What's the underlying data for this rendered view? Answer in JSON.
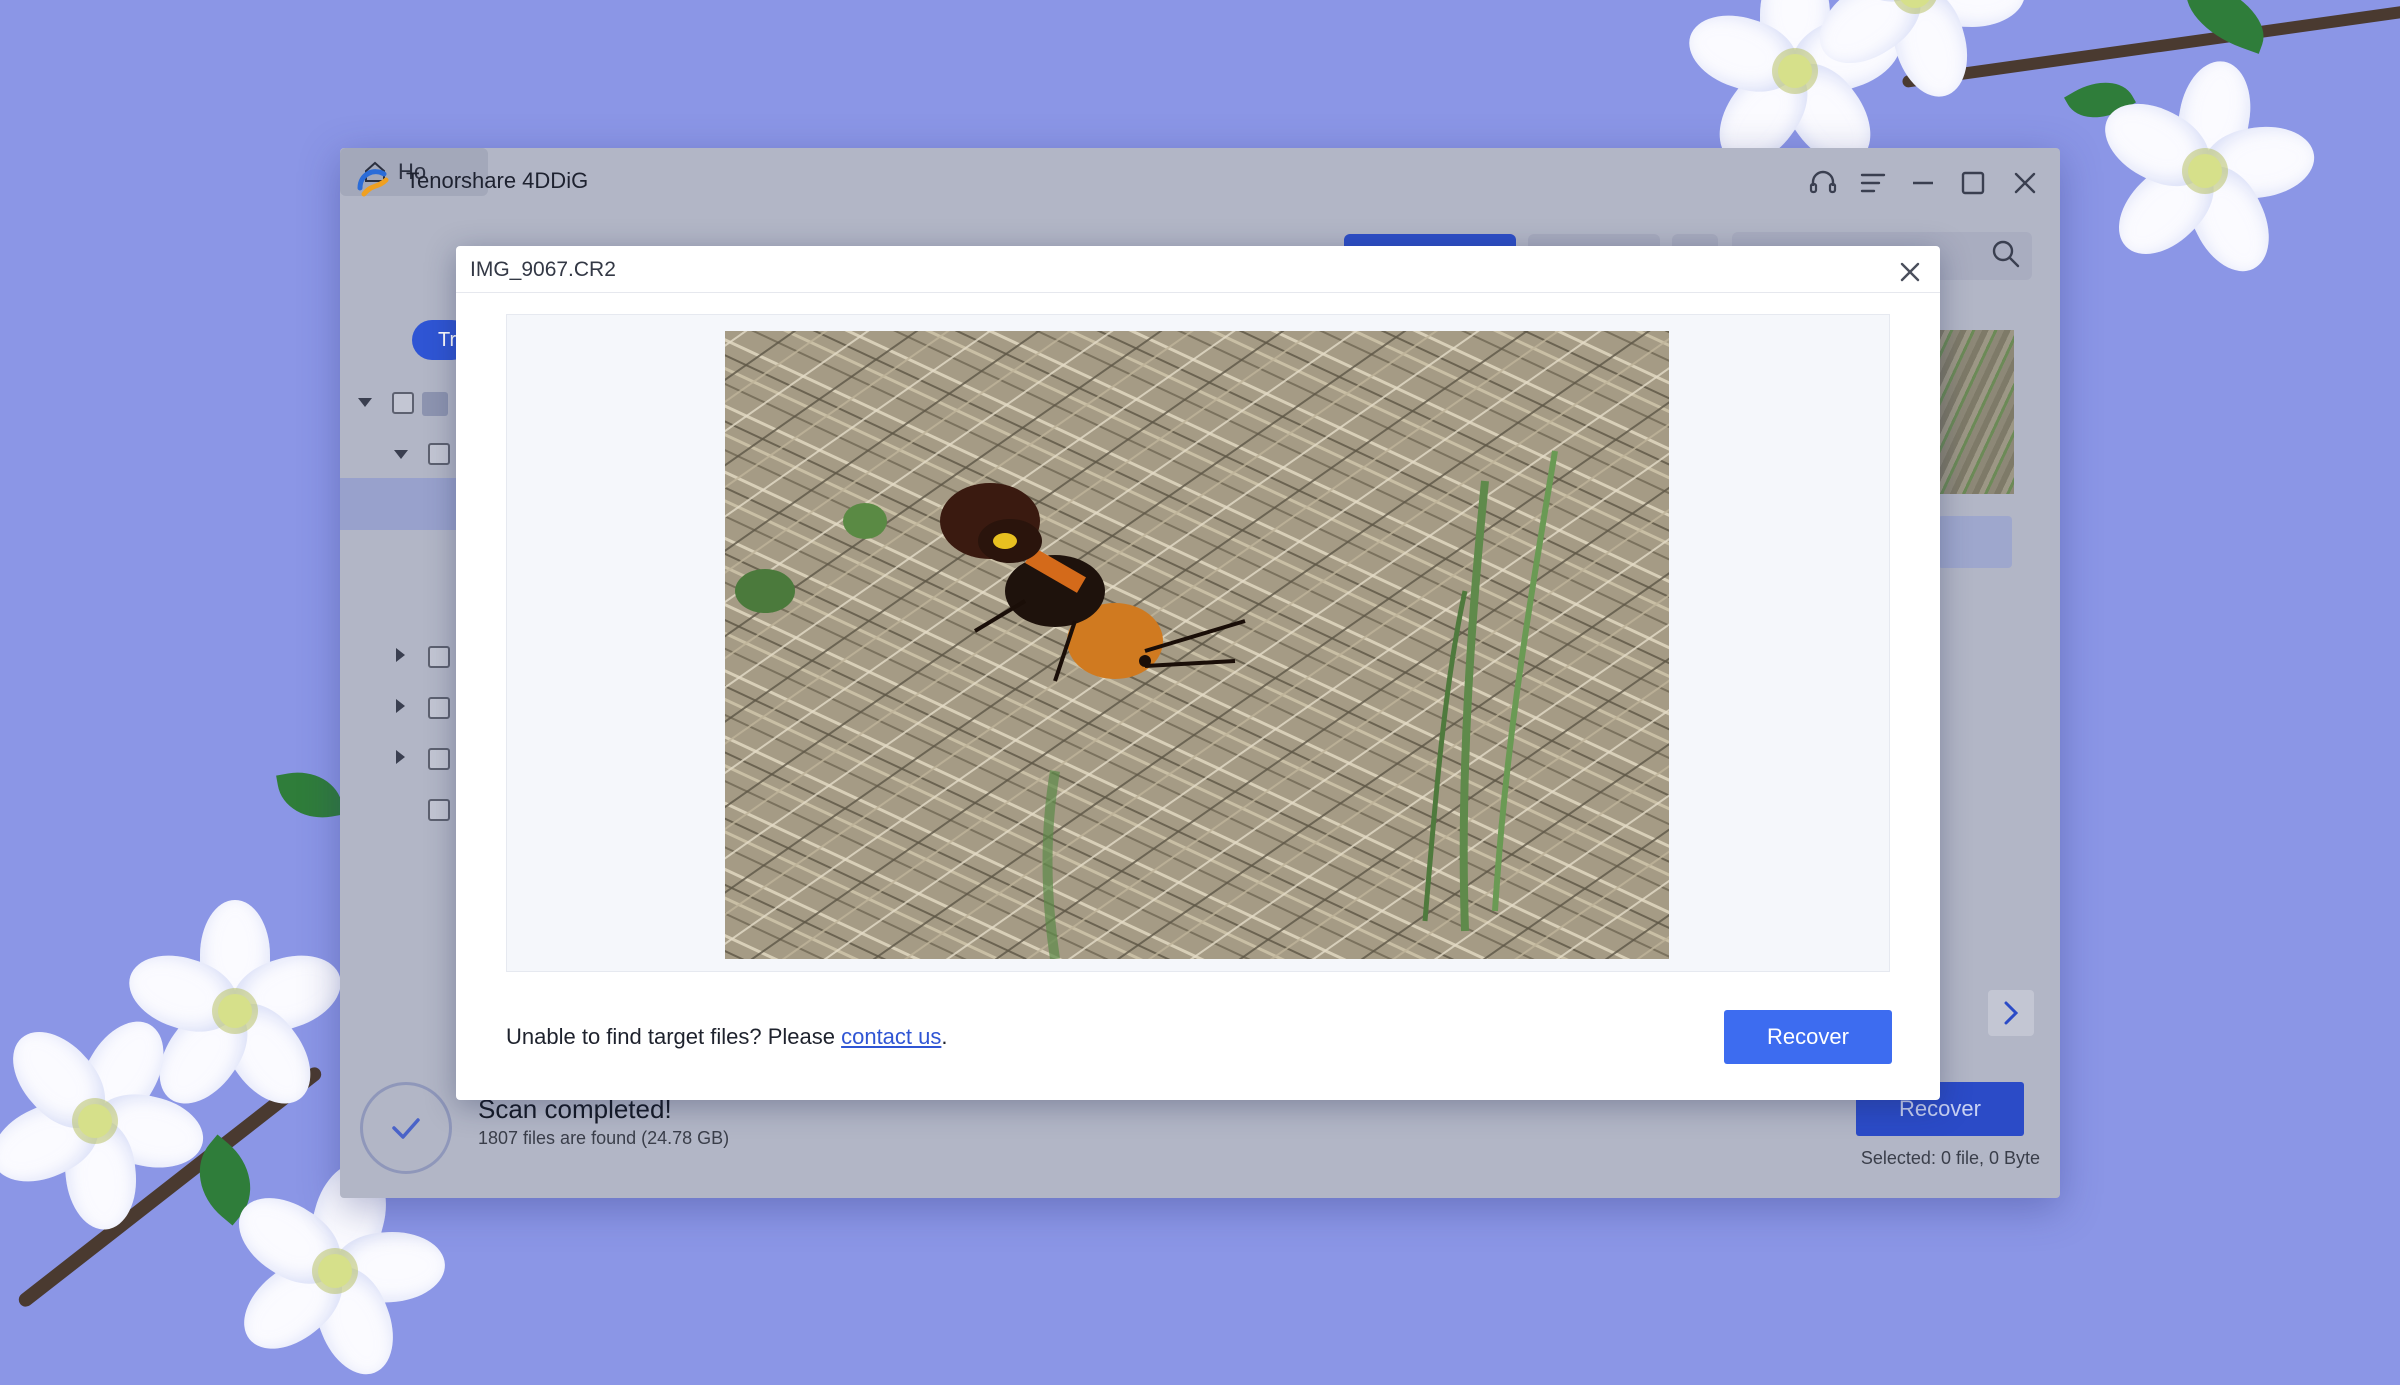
{
  "app": {
    "title": "Tenorshare 4DDiG",
    "home_tab_label": "Ho",
    "tree_pill_label": "Tr"
  },
  "status": {
    "scan_title": "Scan completed!",
    "scan_summary": "1807 files are found (24.78 GB)",
    "selected_info": "Selected: 0 file, 0 Byte",
    "recover_label": "Recover"
  },
  "preview_modal": {
    "file_name": "IMG_9067.CR2",
    "footer_prefix": "Unable to find target files? Please ",
    "contact_link": "contact us",
    "footer_suffix": ".",
    "recover_label": "Recover"
  },
  "colors": {
    "desktop_bg": "#8b96e6",
    "accent": "#3d6cf0",
    "window_dimmed": "#b2b6c6"
  }
}
